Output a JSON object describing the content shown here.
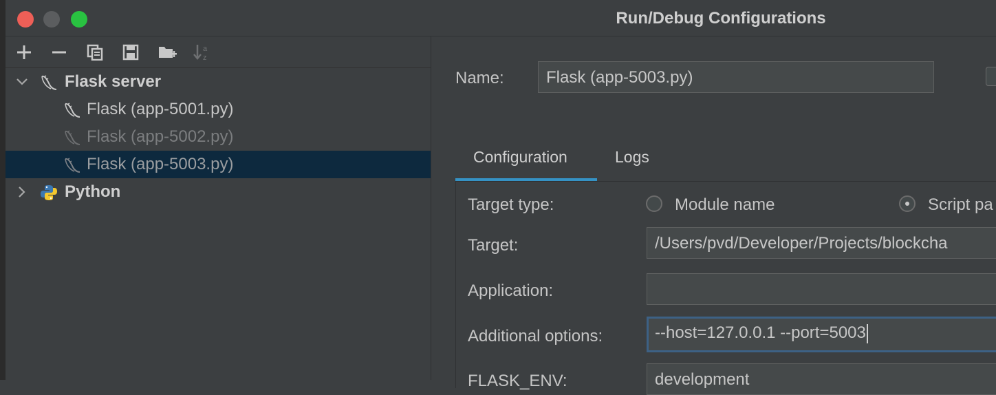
{
  "window": {
    "title": "Run/Debug Configurations"
  },
  "toolbar": {
    "buttons": [
      "add-icon",
      "remove-icon",
      "copy-icon",
      "save-icon",
      "new-folder-icon",
      "sort-icon"
    ]
  },
  "tree": {
    "groups": [
      {
        "label": "Flask server",
        "expanded": true,
        "items": [
          {
            "label": "Flask (app-5001.py)",
            "state": "normal"
          },
          {
            "label": "Flask (app-5002.py)",
            "state": "disabled"
          },
          {
            "label": "Flask (app-5003.py)",
            "state": "selected"
          }
        ]
      },
      {
        "label": "Python",
        "expanded": false
      }
    ]
  },
  "config": {
    "name_label": "Name:",
    "name_value": "Flask (app-5003.py)",
    "tabs": [
      "Configuration",
      "Logs"
    ],
    "active_tab": "Configuration",
    "target_type_label": "Target type:",
    "target_type_options": [
      "Module name",
      "Script pa"
    ],
    "target_type_selected": "Script pa",
    "target_label": "Target:",
    "target_value": "/Users/pvd/Developer/Projects/blockcha",
    "application_label": "Application:",
    "application_value": "",
    "additional_options_label": "Additional options:",
    "additional_options_value": "--host=127.0.0.1 --port=5003",
    "flask_env_label": "FLASK_ENV:",
    "flask_env_value": "development"
  },
  "colors": {
    "background": "#3c3f41",
    "selection": "#0d293e",
    "accent": "#3592c4",
    "close": "#ee5f57",
    "maximize": "#29c241"
  }
}
